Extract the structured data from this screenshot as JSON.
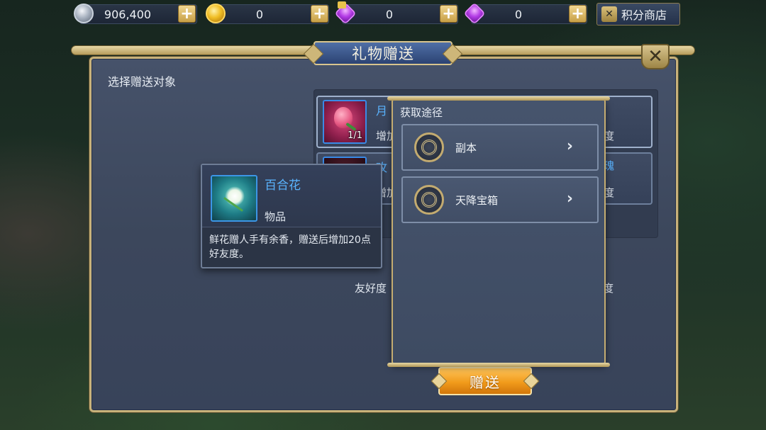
{
  "resources": [
    {
      "icon": "silver-coin-icon",
      "value": "906,400"
    },
    {
      "icon": "gold-coin-icon",
      "value": "0"
    },
    {
      "icon": "locked-gem-icon",
      "value": "0"
    },
    {
      "icon": "gem-icon",
      "value": "0"
    }
  ],
  "shop_button": {
    "label": "积分商店",
    "icon": "shop-icon"
  },
  "dialog": {
    "title": "礼物赠送",
    "choose_label": "选择赠送对象",
    "give_label": "赠送",
    "friendship_label": "友好度",
    "friendship_tail": "度"
  },
  "gift_list": [
    {
      "name": "月",
      "desc": "增加",
      "qty": "1/1",
      "tail": "度"
    },
    {
      "name": "玫",
      "desc": "增加",
      "tail_name": "瑰",
      "tail": "度"
    }
  ],
  "acquire": {
    "title": "获取途径",
    "items": [
      {
        "label": "副本"
      },
      {
        "label": "天降宝箱"
      }
    ]
  },
  "tooltip": {
    "name": "百合花",
    "type": "物品",
    "desc": "鲜花赠人手有余香，赠送后增加20点好友度。"
  },
  "colors": {
    "accent_gold": "#c8b27a",
    "name_blue": "#5ab4ff",
    "give_orange": "#f19b1b"
  }
}
